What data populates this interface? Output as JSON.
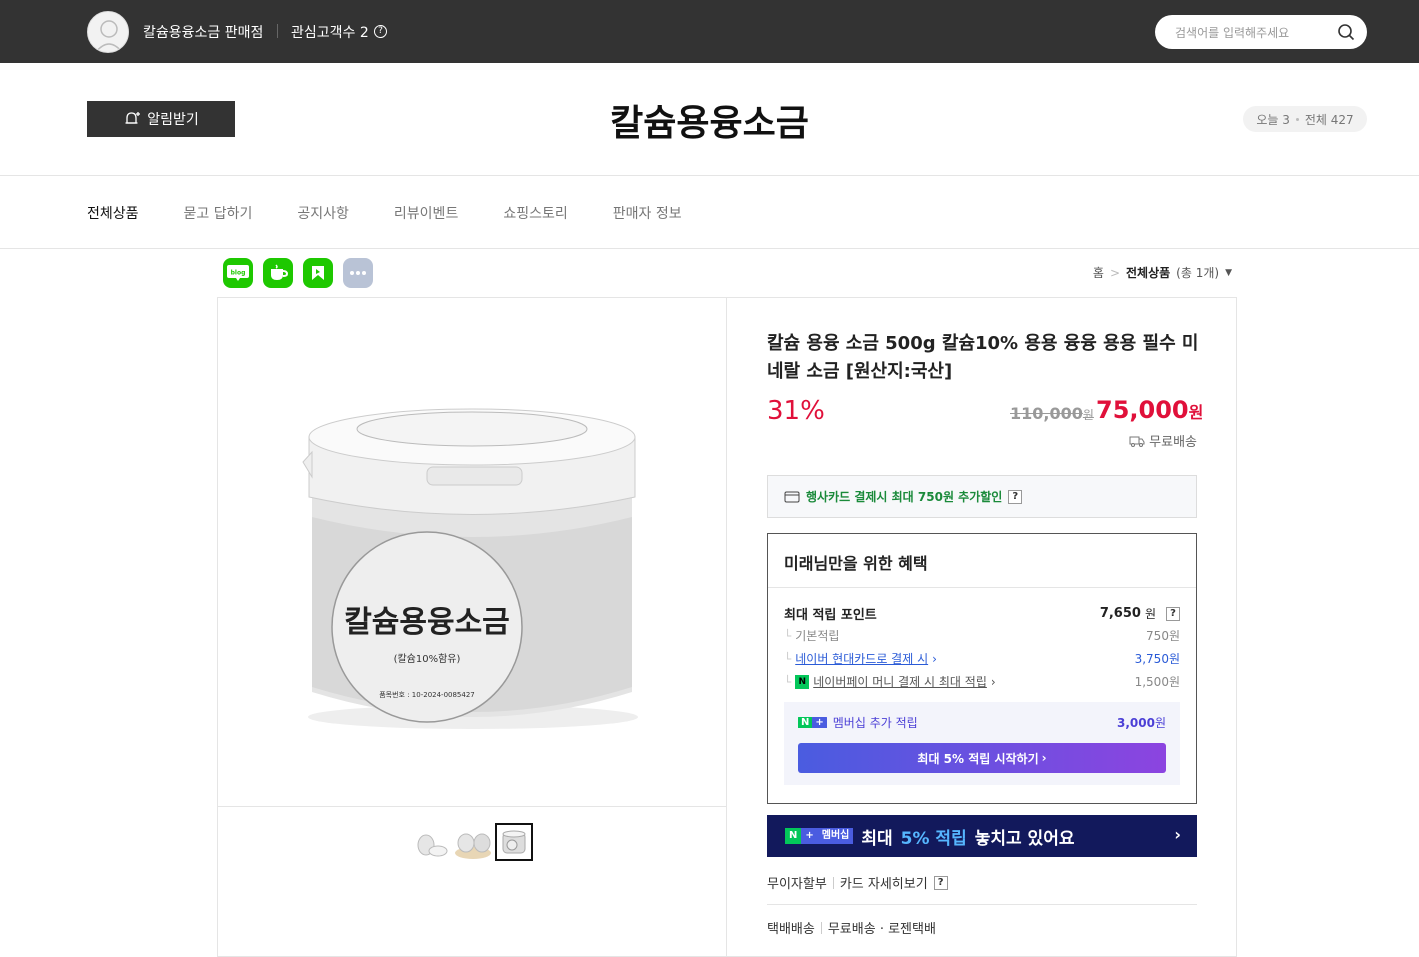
{
  "header": {
    "store_name": "칼슘용융소금 판매점",
    "fans_label": "관심고객수 2",
    "search_placeholder": "검색어를 입력해주세요"
  },
  "shop": {
    "alarm_label": "알림받기",
    "title": "칼슘용융소금",
    "today_label": "오늘 3",
    "total_label": "전체 427"
  },
  "nav": {
    "items": [
      "전체상품",
      "묻고 답하기",
      "공지사항",
      "리뷰이벤트",
      "쇼핑스토리",
      "판매자 정보"
    ]
  },
  "breadcrumb": {
    "home": "홈",
    "current": "전체상품",
    "count": "(총 1개)"
  },
  "product": {
    "title": "칼슘 용융 소금 500g 칼슘10% 용용 융융 용용 필수 미네랄 소금 [원산지:국산]",
    "discount": "31%",
    "original_price": "110,000",
    "original_unit": "원",
    "price": "75,000",
    "price_unit": "원",
    "shipping": "무료배송",
    "card_promo": "행사카드 결제시 최대 750원 추가할인",
    "jar_label": "칼슘용융소금",
    "jar_sub": "(칼슘10%함유)",
    "jar_code": "품목번호 : 10-2024-0085427"
  },
  "benefit": {
    "title": "미래님만을 위한 혜택",
    "max_point_label": "최대 적립 포인트",
    "max_point_value": "7,650",
    "unit": "원",
    "basic_label": "기본적립",
    "basic_value": "750원",
    "card_label": "네이버 현대카드로 결제 시",
    "card_value": "3,750원",
    "pay_label": "네이버페이 머니 결제 시 최대 적립",
    "pay_value": "1,500원",
    "membership_label": "멤버십 추가 적립",
    "membership_value": "3,000",
    "membership_btn": "최대 5% 적립 시작하기"
  },
  "banner": {
    "badge": "멤버십",
    "text_before": "최대",
    "text_highlight": "5% 적립",
    "text_after": "놓치고 있어요"
  },
  "installment": {
    "label": "무이자할부",
    "card_detail": "카드 자세히보기"
  },
  "delivery": {
    "label": "택배배송",
    "detail": "무료배송 · 로젠택배"
  },
  "colors": {
    "topbar": "#333333",
    "sale_red": "#e0103a",
    "naver_green": "#03c75a",
    "membership_navy": "#12195c"
  }
}
